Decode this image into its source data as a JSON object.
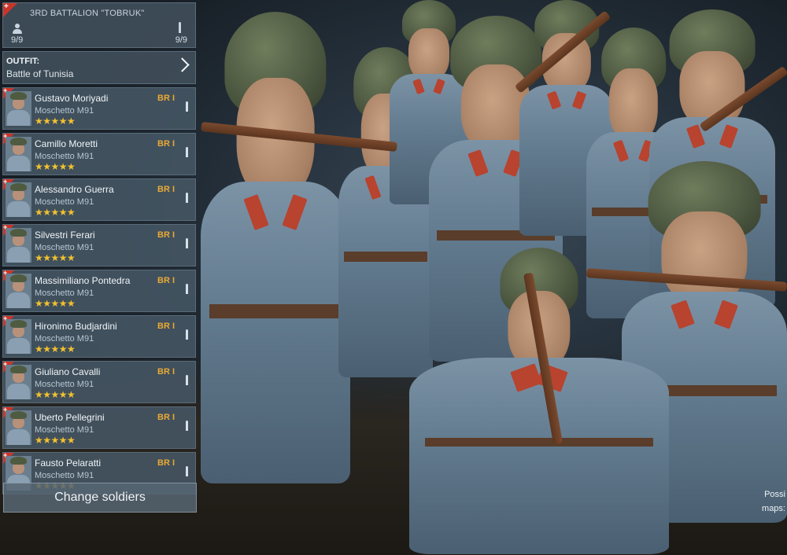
{
  "battalion": {
    "name": "3RD BATTALION \"TOBRUK\"",
    "soldier_count": "9/9",
    "ammo_count": "9/9"
  },
  "outfit": {
    "label": "OUTFIT:",
    "value": "Battle of Tunisia"
  },
  "soldiers": [
    {
      "name": "Gustavo Moriyadi",
      "weapon": "Moschetto M91",
      "rank": "BR I",
      "stars": "★★★★★"
    },
    {
      "name": "Camillo Moretti",
      "weapon": "Moschetto M91",
      "rank": "BR I",
      "stars": "★★★★★"
    },
    {
      "name": "Alessandro Guerra",
      "weapon": "Moschetto M91",
      "rank": "BR I",
      "stars": "★★★★★"
    },
    {
      "name": "Silvestri Ferari",
      "weapon": "Moschetto M91",
      "rank": "BR I",
      "stars": "★★★★★"
    },
    {
      "name": "Massimiliano Pontedra",
      "weapon": "Moschetto M91",
      "rank": "BR I",
      "stars": "★★★★★"
    },
    {
      "name": "Hironimo Budjardini",
      "weapon": "Moschetto M91",
      "rank": "BR I",
      "stars": "★★★★★"
    },
    {
      "name": "Giuliano Cavalli",
      "weapon": "Moschetto M91",
      "rank": "BR I",
      "stars": "★★★★★"
    },
    {
      "name": "Uberto Pellegrini",
      "weapon": "Moschetto M91",
      "rank": "BR I",
      "stars": "★★★★★"
    },
    {
      "name": "Fausto Pelaratti",
      "weapon": "Moschetto M91",
      "rank": "BR I",
      "stars": "★★★★★"
    }
  ],
  "buttons": {
    "change_soldiers": "Change soldiers"
  },
  "hint": {
    "line1": "Possi",
    "line2": "maps:"
  },
  "colors": {
    "rank": "#e9a935",
    "stars": "#f2c12e",
    "flag": "#c9352a"
  }
}
